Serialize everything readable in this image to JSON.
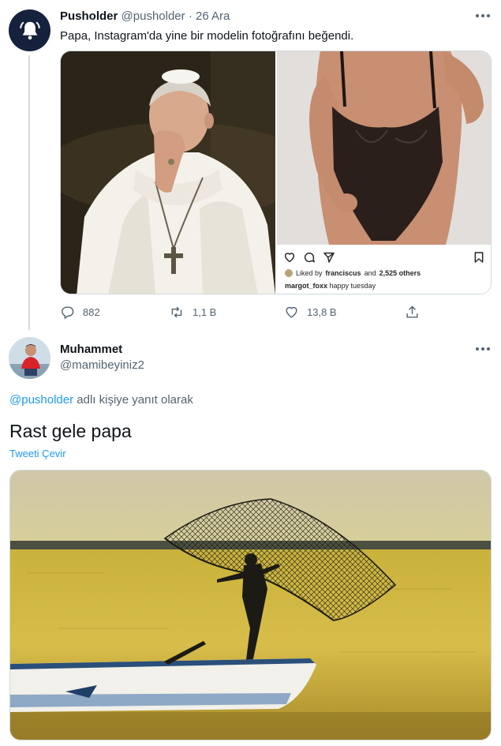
{
  "tweet1": {
    "display_name": "Pusholder",
    "handle": "@pusholder",
    "separator": "·",
    "date": "26 Ara",
    "avatar_icon": "bell-icon",
    "text": "Papa, Instagram'da yine bir modelin fotoğrafını beğendi.",
    "instagram": {
      "liked_by_prefix": "Liked by",
      "liked_by_user": "franciscus",
      "liked_by_and": "and",
      "liked_by_others": "2,525 others",
      "caption_user": "margot_foxx",
      "caption_text": "happy tuesday"
    },
    "actions": {
      "replies": "882",
      "retweets": "1,1 B",
      "likes": "13,8 B"
    }
  },
  "tweet2": {
    "display_name": "Muhammet",
    "handle": "@mamibeyiniz2",
    "reply_mention": "@pusholder",
    "reply_suffix": "adlı kişiye yanıt olarak",
    "text": "Rast gele papa",
    "translate_label": "Tweeti Çevir"
  },
  "colors": {
    "accent": "#1d9bf0",
    "secondary_text": "#536471",
    "avatar_bg": "#15213d"
  }
}
